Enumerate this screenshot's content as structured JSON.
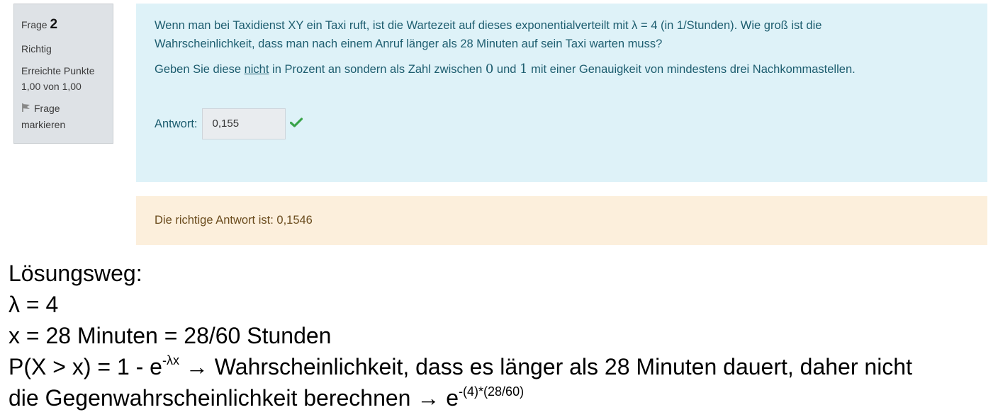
{
  "info": {
    "frage_label": "Frage",
    "frage_number": "2",
    "status": "Richtig",
    "points_label": "Erreichte Punkte",
    "points_value": "1,00 von 1,00",
    "flag_label_1": "Frage",
    "flag_label_2": "markieren"
  },
  "question": {
    "text_line1": "Wenn man bei Taxidienst XY ein Taxi ruft, ist die Wartezeit auf dieses exponentialverteilt mit λ = 4 (in 1/Stunden). Wie groß ist die",
    "text_line2": "Wahrscheinlichkeit, dass man nach einem Anruf länger als 28 Minuten auf sein Taxi warten muss?",
    "instr_a": "Geben Sie diese ",
    "instr_nicht": "nicht",
    "instr_b": " in Prozent an sondern als Zahl zwischen ",
    "instr_zero": "0",
    "instr_c": " und ",
    "instr_one": "1",
    "instr_d": " mit einer Genauigkeit von mindestens drei Nachkommastellen.",
    "answer_label": "Antwort:",
    "answer_value": "0,155"
  },
  "feedback": {
    "text": "Die richtige Antwort ist: 0,1546"
  },
  "solution": {
    "heading": "Lösungsweg:",
    "line_lambda": "λ = 4",
    "line_x": "x = 28 Minuten = 28/60 Stunden",
    "line_p_a": "P(X > x) = 1 - e",
    "line_p_exp": "-λx",
    "line_p_b": " → Wahrscheinlichkeit, dass es länger als 28 Minuten dauert, daher nicht",
    "line_g_a": "die Gegenwahrscheinlichkeit berechnen → e",
    "line_g_exp": "-(4)*(28/60)"
  },
  "colors": {
    "question_bg": "#def2f8",
    "question_text": "#1d5d6f",
    "feedback_bg": "#fcefdc",
    "feedback_text": "#6b4c1e",
    "check": "#3aa44a"
  }
}
